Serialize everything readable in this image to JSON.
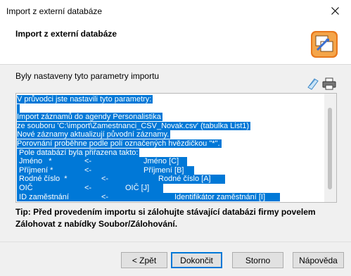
{
  "window": {
    "title": "Import z externí databáze"
  },
  "header": {
    "title": "Import z externí databáze"
  },
  "section": {
    "label": "Byly nastaveny tyto parametry importu"
  },
  "textbox": {
    "lines": [
      "V průvodci jste nastavili tyto parametry:",
      "",
      "Import záznamů do agendy Personalistika",
      "ze souboru 'C:\\import\\Zamestnanci_CSV_Novak.csv' (tabulka List1)",
      "Nové záznamy aktualizují původní záznamy.",
      "Porovnání proběhne podle polí označených hvězdičkou \"*\".",
      " Pole databází byla přiřazena takto:"
    ],
    "mapping": [
      {
        "source": " Jméno   *",
        "arrow": "<-",
        "target": "Jméno [C]"
      },
      {
        "source": " Příjmení *",
        "arrow": "<-",
        "target": "Příjmení [B]"
      },
      {
        "source": " Rodné číslo  *",
        "arrow": "<-",
        "target": "Rodné číslo [A]"
      },
      {
        "source": " OIČ",
        "arrow": "<-",
        "target": "OIČ [J]"
      },
      {
        "source": " ID zaměstnání",
        "arrow": "<-",
        "target": "Identifikátor zaměstnání [I]"
      }
    ]
  },
  "tip": {
    "text": "Tip: Před provedením importu si zálohujte stávající databázi firmy povelem Zálohovat z nabídky Soubor/Zálohování."
  },
  "buttons": {
    "back": "< Zpět",
    "finish": "Dokončit",
    "cancel": "Storno",
    "help": "Nápověda"
  },
  "colors": {
    "selection": "#0078d7",
    "default_button_border": "#0078d7"
  }
}
